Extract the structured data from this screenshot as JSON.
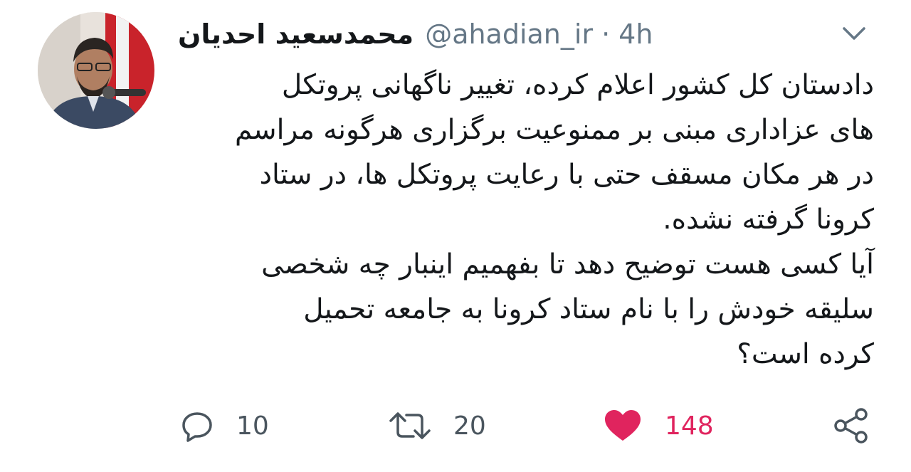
{
  "tweet": {
    "display_name": "محمدسعید احدیان",
    "handle": "@ahadian_ir",
    "separator": "·",
    "time": "4h",
    "lines": [
      "دادستان کل کشور اعلام کرده، تغییر ناگهانی پروتکل",
      "های عزاداری مبنی بر ممنوعیت برگزاری هرگونه مراسم",
      "در هر مکان مسقف حتی با رعایت پروتکل ها، در ستاد",
      "کرونا گرفته نشده.",
      "آیا کسی هست توضیح دهد تا بفهمیم اینبار چه شخصی",
      "سلیقه خودش را با نام ستاد کرونا به جامعه تحمیل",
      "کرده است؟"
    ],
    "actions": {
      "reply_count": "10",
      "retweet_count": "20",
      "like_count": "148"
    }
  },
  "colors": {
    "text": "#14171a",
    "muted": "#657786",
    "like": "#e0245e",
    "icon": "#4a555e"
  },
  "icons": {
    "caret": "chevron-down-icon",
    "reply": "reply-icon",
    "retweet": "retweet-icon",
    "like": "heart-icon",
    "share": "share-icon"
  }
}
